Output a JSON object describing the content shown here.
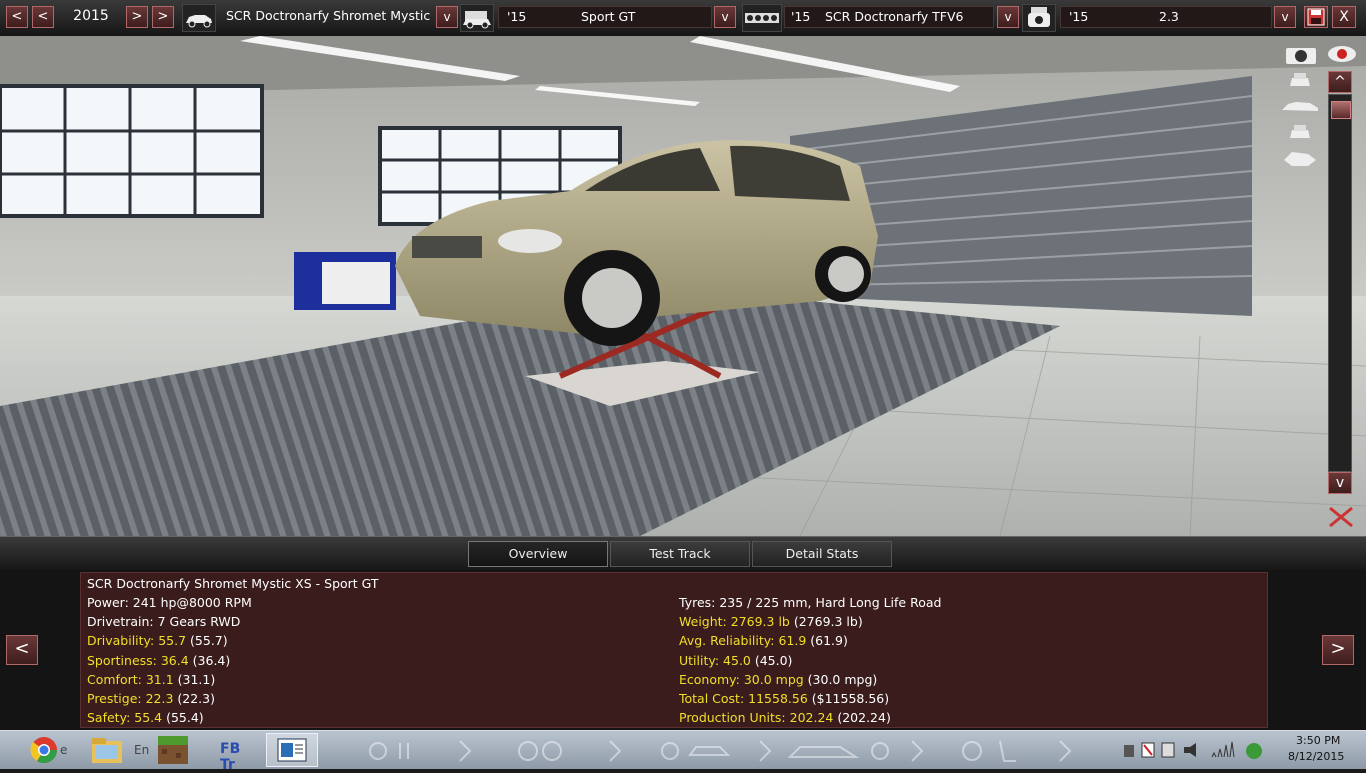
{
  "topbar": {
    "year": "2015",
    "model_name": "SCR Doctronarfy Shromet Mystic XS",
    "trim_year": "'15",
    "trim_name": "Sport GT",
    "engine_year": "'15",
    "engine_name": "SCR Doctronarfy TFV6",
    "variant_year": "'15",
    "variant_name": "2.3",
    "dropdown_label": "v",
    "prev_label": "<",
    "next_label": ">",
    "close_label": "X"
  },
  "sidebar": {
    "scroll_up": "^",
    "scroll_down": "v"
  },
  "tabs": [
    {
      "label": "Overview"
    },
    {
      "label": "Test Track"
    },
    {
      "label": "Detail Stats"
    }
  ],
  "stats": {
    "title": "SCR Doctronarfy Shromet Mystic XS - Sport GT",
    "left": [
      {
        "label": "Power: 241 hp@8000 RPM",
        "extra": ""
      },
      {
        "label": "Drivetrain: 7 Gears RWD",
        "extra": ""
      },
      {
        "label": "Drivability: 55.7",
        "extra": " (55.7)"
      },
      {
        "label": "Sportiness: 36.4",
        "extra": " (36.4)"
      },
      {
        "label": "Comfort: 31.1",
        "extra": " (31.1)"
      },
      {
        "label": "Prestige: 22.3",
        "extra": " (22.3)"
      },
      {
        "label": "Safety: 55.4",
        "extra": " (55.4)"
      }
    ],
    "right": [
      {
        "label": "Tyres: 235 / 225 mm, Hard Long Life Road",
        "extra": ""
      },
      {
        "label": "Weight: 2769.3 lb",
        "extra": " (2769.3 lb)"
      },
      {
        "label": "Avg. Reliability: 61.9",
        "extra": " (61.9)"
      },
      {
        "label": "Utility: 45.0",
        "extra": " (45.0)"
      },
      {
        "label": "Economy: 30.0 mpg",
        "extra": " (30.0 mpg)"
      },
      {
        "label": "Total Cost: 11558.56",
        "extra": " ($11558.56)"
      },
      {
        "label": "Production Units: 202.24",
        "extra": " (202.24)"
      }
    ],
    "nav_prev": "<",
    "nav_next": ">"
  },
  "taskbar": {
    "item_en": "En",
    "item_fb": "FB Tr",
    "item_e": "e",
    "time": "3:50 PM",
    "date": "8/12/2015"
  },
  "colors": {
    "accent": "#6a3838",
    "highlight": "#f1df2a",
    "panel": "#3a1c1c"
  }
}
